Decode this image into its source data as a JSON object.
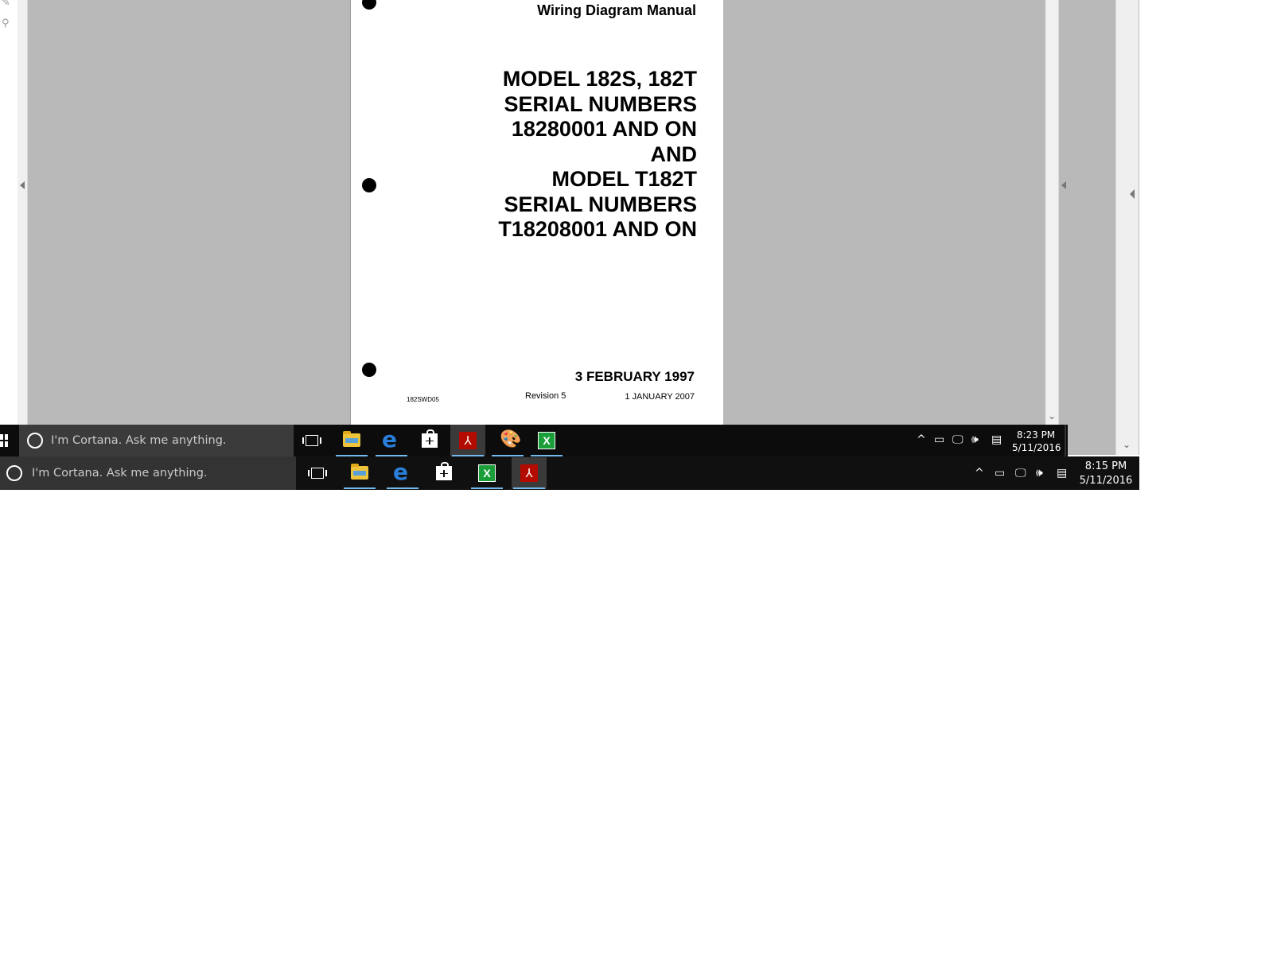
{
  "document": {
    "heading": "Wiring Diagram Manual",
    "model_lines": [
      "MODEL 182S, 182T",
      "SERIAL NUMBERS",
      "18280001 AND ON",
      "AND",
      "MODEL T182T",
      "SERIAL NUMBERS",
      "T18208001 AND ON"
    ],
    "date": "3 FEBRUARY 1997",
    "code": "182SWD05",
    "revision": "Revision 5",
    "revision_date": "1 JANUARY 2007"
  },
  "taskbar_front": {
    "search_placeholder": "I'm Cortana. Ask me anything.",
    "clock_time": "8:23 PM",
    "clock_date": "5/11/2016"
  },
  "taskbar_back": {
    "search_placeholder": "I'm Cortana. Ask me anything.",
    "clock_time": "8:15 PM",
    "clock_date": "5/11/2016"
  },
  "icons": {
    "scroll_down": "⌄",
    "acrobat": "⅄",
    "paint": "🎨",
    "xapp": "X",
    "edge": "e",
    "tray_chevron": "^",
    "tray_battery": "▭",
    "tray_network": "🖵",
    "tray_volume": "🕪",
    "tray_notifications": "▤",
    "tool_pen": "✎"
  }
}
